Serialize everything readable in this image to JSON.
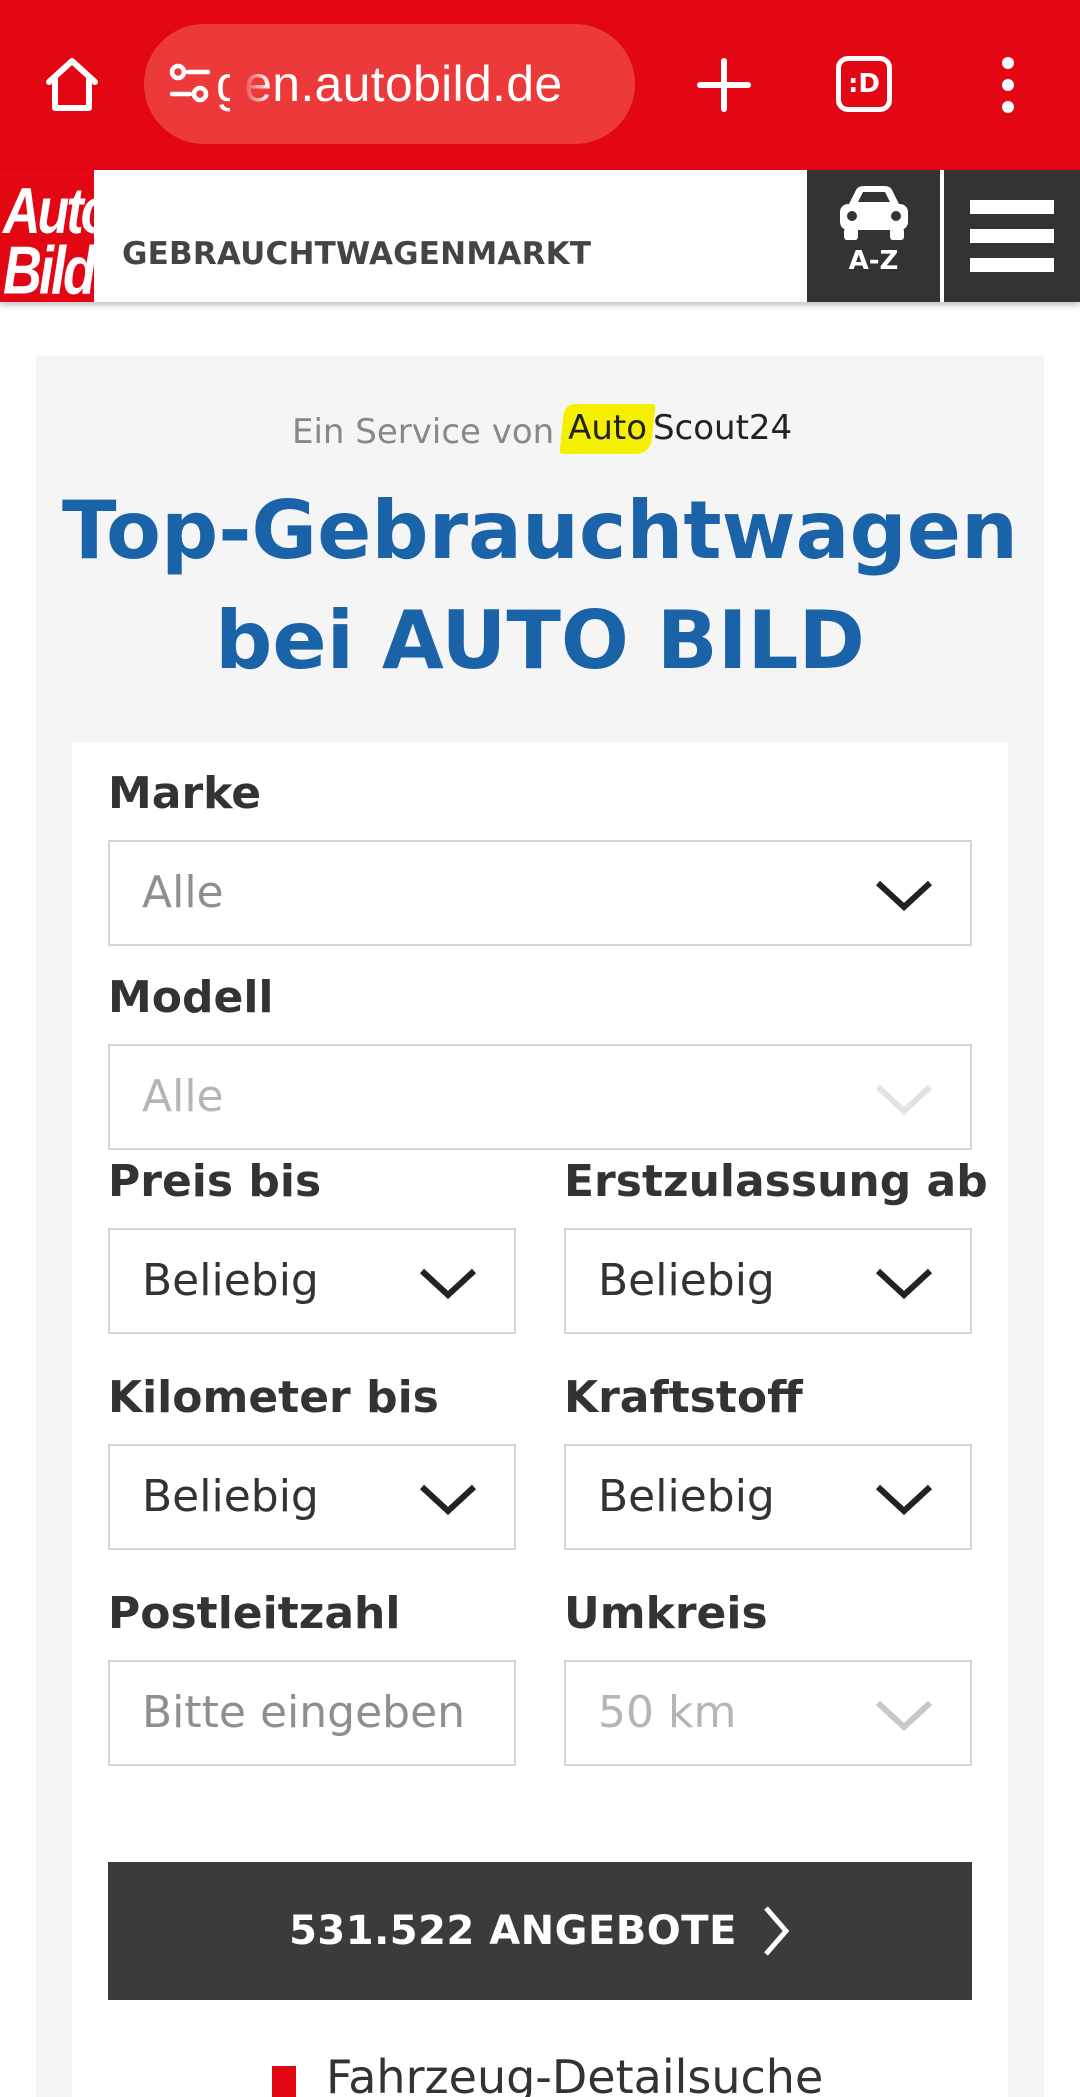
{
  "browser": {
    "url": "gen.autobild.de",
    "tabs_label": ":D"
  },
  "header": {
    "logo_line1": "Auto",
    "logo_line2": "Bild",
    "section_title": "GEBRAUCHTWAGENMARKT",
    "az_label": "A-Z"
  },
  "search": {
    "service_prefix": "Ein Service von",
    "partner_highlight": "Auto",
    "partner_rest": "Scout24",
    "headline_line1": "Top-Gebrauchtwagen",
    "headline_line2": "bei AUTO BILD",
    "fields": {
      "marke": {
        "label": "Marke",
        "value": "Alle"
      },
      "modell": {
        "label": "Modell",
        "value": "Alle"
      },
      "preis": {
        "label": "Preis bis",
        "value": "Beliebig"
      },
      "erstzulassung": {
        "label": "Erstzulassung ab",
        "value": "Beliebig"
      },
      "kilometer": {
        "label": "Kilometer bis",
        "value": "Beliebig"
      },
      "kraftstoff": {
        "label": "Kraftstoff",
        "value": "Beliebig"
      },
      "plz": {
        "label": "Postleitzahl",
        "placeholder": "Bitte eingeben"
      },
      "umkreis": {
        "label": "Umkreis",
        "value": "50 km"
      }
    },
    "submit_label": "531.522 ANGEBOTE",
    "detail_link": "Fahrzeug-Detailsuche"
  },
  "colors": {
    "brand_red": "#e30613",
    "headline_blue": "#1a63a8",
    "cta_dark": "#3b3b3b",
    "highlight_yellow": "#f5f000"
  },
  "icons": [
    "home-icon",
    "site-settings-icon",
    "plus-icon",
    "tab-switcher-icon",
    "overflow-menu-icon",
    "car-icon",
    "hamburger-menu-icon",
    "chevron-down-icon",
    "chevron-right-icon"
  ]
}
